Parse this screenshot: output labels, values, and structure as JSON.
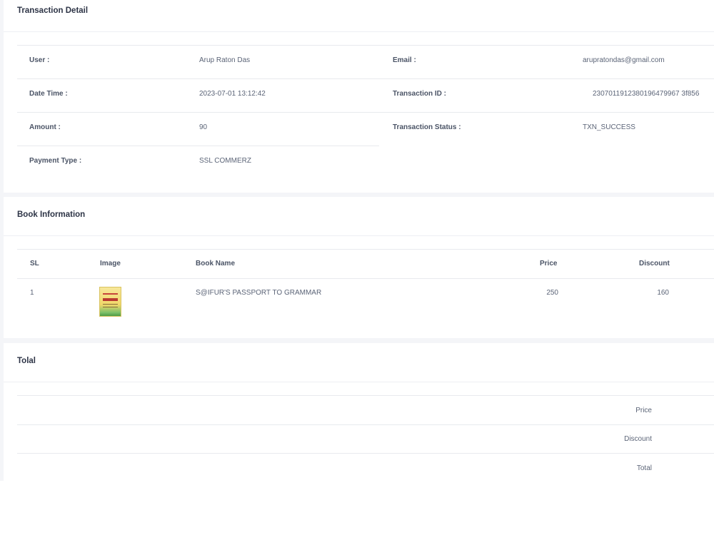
{
  "transaction": {
    "title": "Transaction Detail",
    "user_label": "User :",
    "user_value": "Arup Raton Das",
    "email_label": "Email :",
    "email_value": "arupratondas@gmail.com",
    "datetime_label": "Date Time :",
    "datetime_value": "2023-07-01 13:12:42",
    "txn_id_label": "Transaction ID :",
    "txn_id_value": "2307011912380196479967 3f856",
    "amount_label": "Amount :",
    "amount_value": "90",
    "status_label": "Transaction Status :",
    "status_value": "TXN_SUCCESS",
    "payment_label": "Payment Type :",
    "payment_value": "SSL COMMERZ"
  },
  "books": {
    "title": "Book Information",
    "columns": [
      "SL",
      "Image",
      "Book Name",
      "Price",
      "Discount"
    ],
    "rows": [
      {
        "sl": "1",
        "image": "book-cover",
        "name": "S@IFUR'S PASSPORT TO GRAMMAR",
        "price": "250",
        "discount": "160"
      }
    ]
  },
  "total": {
    "title": "Tolal",
    "rows": [
      "Price",
      "Discount",
      "Total"
    ]
  },
  "colors": {
    "page_bg": "#f4f5f8",
    "card_bg": "#ffffff",
    "title": "#2d3446",
    "text": "#5b6477",
    "divider": "#e8eaee"
  }
}
